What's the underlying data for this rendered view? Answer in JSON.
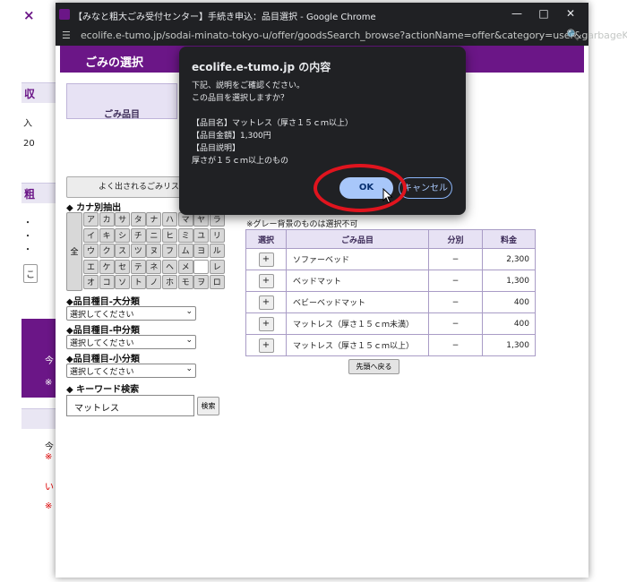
{
  "window": {
    "title": "【みなと粗大ごみ受付センター】手続き申込：品目選択 - Google Chrome",
    "url": "ecolife.e-tumo.jp/sodai-minato-tokyo-u/offer/goodsSearch_browse?actionName=offer&category=user&garbageKbn=..."
  },
  "background": {
    "close_mark": "×",
    "heading_1": "収",
    "line_1": "入",
    "line_2": "20",
    "heading_2": "粗",
    "bullets": [
      "・",
      "・",
      "・"
    ],
    "misc": "こ",
    "purple_lines": [
      "今",
      "※"
    ],
    "lower_lines": [
      "今",
      "※",
      "い",
      "※"
    ]
  },
  "page": {
    "section_title": "ごみの選択",
    "category_label": "ごみ品目",
    "fav_button": "よく出されるごみリスト検",
    "kana_label": "◆ カナ別抽出",
    "kana_all": "全",
    "kana_rows": [
      [
        "ア",
        "カ",
        "サ",
        "タ",
        "ナ",
        "ハ",
        "マ",
        "ヤ",
        "ラ"
      ],
      [
        "イ",
        "キ",
        "シ",
        "チ",
        "ニ",
        "ヒ",
        "ミ",
        "ユ",
        "リ"
      ],
      [
        "ウ",
        "ク",
        "ス",
        "ツ",
        "ヌ",
        "フ",
        "ム",
        "ヨ",
        "ル"
      ],
      [
        "エ",
        "ケ",
        "セ",
        "テ",
        "ネ",
        "ヘ",
        "メ",
        "",
        "レ"
      ],
      [
        "オ",
        "コ",
        "ソ",
        "ト",
        "ノ",
        "ホ",
        "モ",
        "ヲ",
        "ロ"
      ]
    ],
    "large_cat_label": "◆品目種目-大分類",
    "mid_cat_label": "◆品目種目-中分類",
    "small_cat_label": "◆品目種目-小分類",
    "select_placeholder": "選択してください",
    "keyword_label": "◆ キーワード検索",
    "keyword_value": "マットレス",
    "search_button": "検索",
    "gray_note": "※グレー背景のものは選択不可",
    "table_headers": [
      "選択",
      "ごみ品目",
      "分別",
      "料金"
    ],
    "rows": [
      {
        "select": "+",
        "name": "ソファーベッド",
        "class": "−",
        "fee": "2,300"
      },
      {
        "select": "+",
        "name": "ベッドマット",
        "class": "−",
        "fee": "1,300"
      },
      {
        "select": "+",
        "name": "ベビーベッドマット",
        "class": "−",
        "fee": "400"
      },
      {
        "select": "+",
        "name": "マットレス（厚さ１５ｃｍ未満）",
        "class": "−",
        "fee": "400"
      },
      {
        "select": "+",
        "name": "マットレス（厚さ１５ｃｍ以上）",
        "class": "−",
        "fee": "1,300"
      }
    ],
    "back_button": "先頭へ戻る"
  },
  "dialog": {
    "title": "ecolife.e-tumo.jp の内容",
    "lines": [
      "下記、説明をご確認ください。",
      "この品目を選択しますか？",
      "",
      "【品目名】マットレス（厚さ１５ｃｍ以上）",
      "【品目金額】1,300円",
      "【品目説明】",
      "厚さが１５ｃｍ以上のもの"
    ],
    "ok": "OK",
    "cancel": "キャンセル"
  },
  "colors": {
    "brand_purple": "#6b1687",
    "header_lavender": "#e7e2f4",
    "dialog_bg": "#202124",
    "ok_blue": "#a8c7fa",
    "highlight_red": "#e0141e"
  }
}
